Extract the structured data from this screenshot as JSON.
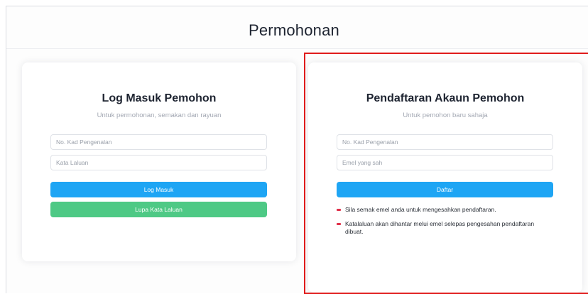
{
  "page": {
    "title": "Permohonan"
  },
  "login": {
    "title": "Log Masuk Pemohon",
    "subtitle": "Untuk permohonan, semakan dan rayuan",
    "ic_placeholder": "No. Kad Pengenalan",
    "password_placeholder": "Kata Laluan",
    "login_label": "Log Masuk",
    "forgot_label": "Lupa Kata Laluan"
  },
  "register": {
    "title": "Pendaftaran Akaun Pemohon",
    "subtitle": "Untuk pemohon baru sahaja",
    "ic_placeholder": "No. Kad Pengenalan",
    "email_placeholder": "Emel yang sah",
    "register_label": "Daftar",
    "notes": [
      "Sila semak emel anda untuk mengesahkan pendaftaran.",
      "Katalaluan akan dihantar melui emel selepas pengesahan pendaftaran dibuat."
    ]
  },
  "colors": {
    "primary": "#1ea5f4",
    "success": "#4ec985",
    "bullet": "#e0304a",
    "highlight": "#e01b1b"
  }
}
